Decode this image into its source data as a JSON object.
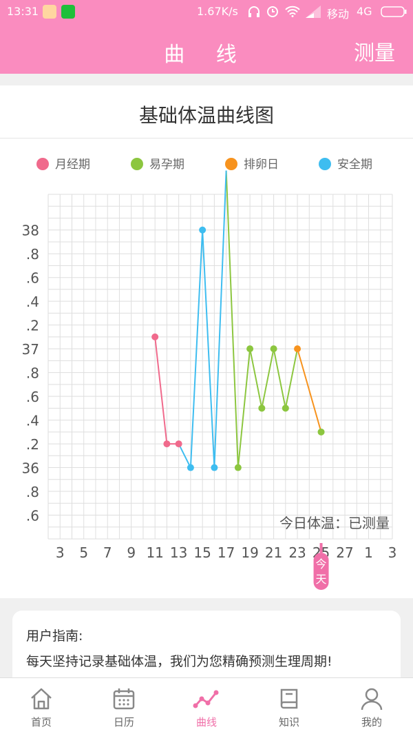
{
  "status_bar": {
    "time": "13:31",
    "speed": "1.67K/s",
    "carrier": "移动",
    "network": "4G",
    "icons": [
      "avatar-icon",
      "iqiyi-icon",
      "headphones-icon",
      "alarm-icon",
      "wifi-icon",
      "signal-icon",
      "battery-icon"
    ]
  },
  "app_bar": {
    "title": "曲 线",
    "action_label": "测量"
  },
  "chart_card": {
    "title": "基础体温曲线图",
    "legend": [
      {
        "label": "月经期",
        "color": "#f06a8c"
      },
      {
        "label": "易孕期",
        "color": "#8cc63f"
      },
      {
        "label": "排卵日",
        "color": "#f7931e"
      },
      {
        "label": "安全期",
        "color": "#3ebdf0"
      }
    ],
    "today_temp_label": "今日体温：已测量",
    "today_marker_label": "今天"
  },
  "chart_data": {
    "type": "line",
    "xlabel": "",
    "ylabel": "",
    "y_tick_labels": [
      "38",
      ".8",
      ".6",
      ".4",
      ".2",
      "37",
      ".8",
      ".6",
      ".4",
      ".2",
      "36",
      ".8",
      ".6"
    ],
    "y_tick_values": [
      38.0,
      37.8,
      37.6,
      37.4,
      37.2,
      37.0,
      36.8,
      36.6,
      36.4,
      36.2,
      36.0,
      35.8,
      35.6
    ],
    "ylim": [
      35.4,
      38.3
    ],
    "x_tick_labels": [
      "3",
      "5",
      "7",
      "9",
      "11",
      "13",
      "15",
      "17",
      "19",
      "21",
      "23",
      "25",
      "27",
      "1",
      "3"
    ],
    "x_tick_values": [
      3,
      5,
      7,
      9,
      11,
      13,
      15,
      17,
      19,
      21,
      23,
      25,
      27,
      29,
      31
    ],
    "xlim": [
      2,
      31
    ],
    "today_x": 25,
    "grid": true,
    "series": [
      {
        "name": "月经期",
        "color": "#f06a8c",
        "x": [
          11,
          12,
          13
        ],
        "y": [
          37.1,
          36.2,
          36.2
        ]
      },
      {
        "name": "安全期",
        "color": "#3ebdf0",
        "x": [
          14,
          15,
          16,
          17
        ],
        "y": [
          36.0,
          38.0,
          36.0,
          38.5
        ]
      },
      {
        "name": "易孕期",
        "color": "#8cc63f",
        "x": [
          18,
          19,
          20,
          21,
          22
        ],
        "y": [
          36.0,
          37.0,
          36.5,
          37.0,
          36.5
        ]
      },
      {
        "name": "排卵日",
        "color": "#f7931e",
        "x": [
          23
        ],
        "y": [
          37.0
        ]
      },
      {
        "name": "易孕期",
        "color": "#8cc63f",
        "x": [
          25
        ],
        "y": [
          36.3
        ]
      }
    ],
    "segments": [
      {
        "x": [
          13,
          14
        ],
        "y": [
          36.2,
          36.0
        ],
        "color": "#3ebdf0"
      },
      {
        "x": [
          17,
          18
        ],
        "y": [
          38.5,
          36.0
        ],
        "color": "#8cc63f"
      },
      {
        "x": [
          22,
          23
        ],
        "y": [
          36.5,
          37.0
        ],
        "color": "#8cc63f"
      },
      {
        "x": [
          23,
          25
        ],
        "y": [
          37.0,
          36.3
        ],
        "color": "#f7931e"
      }
    ]
  },
  "guide": {
    "title": "用户指南:",
    "text": "每天坚持记录基础体温，我们为您精确预测生理周期!"
  },
  "tabs": [
    {
      "label": "首页",
      "icon": "home-icon",
      "active": false
    },
    {
      "label": "日历",
      "icon": "calendar-icon",
      "active": false
    },
    {
      "label": "曲线",
      "icon": "curve-icon",
      "active": true
    },
    {
      "label": "知识",
      "icon": "book-icon",
      "active": false
    },
    {
      "label": "我的",
      "icon": "profile-icon",
      "active": false
    }
  ],
  "colors": {
    "brand": "#fa8cbf",
    "tab_active": "#f06fa8"
  }
}
